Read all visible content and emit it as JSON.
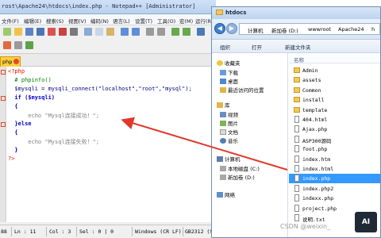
{
  "npp": {
    "title": "rost\\Apache24\\htdocs\\index.php - Notepad++ [Administrator]",
    "menu": [
      "文件(F)",
      "编辑(E)",
      "搜索(S)",
      "视图(V)",
      "编码(N)",
      "语言(L)",
      "设置(T)",
      "工具(O)",
      "宏(M)",
      "运行(R)"
    ],
    "tab_label": "php",
    "code": [
      "<?php",
      "  # phpinfo()",
      "  $mysqli = mysqli_connect(\"localhost\",\"root\",\"mysql\");",
      "  if ($mysqli)",
      "  {",
      "      echo \"Mysql连接成功！\";",
      "  }else",
      "  {",
      "      echo \"Mysql连接失败！\";",
      "  }",
      "?>"
    ],
    "status": {
      "ln": "88",
      "line": "Ln : 11",
      "col": "Col : 3",
      "sel": "Sel : 0 | 0",
      "eol": "Windows (CR LF)",
      "enc": "GB2312 (Si"
    }
  },
  "explorer": {
    "title": "htdocs",
    "address": [
      "计算机",
      "新加卷 (D:)",
      "wwwroot",
      "Apache24",
      "h"
    ],
    "commands": [
      "组织",
      "打开",
      "新建文件夹"
    ],
    "nav": [
      {
        "label": "收藏夹",
        "icon": "star-icon"
      },
      {
        "label": "下载",
        "icon": "download-folder-icon"
      },
      {
        "label": "桌面",
        "icon": "desktop-icon"
      },
      {
        "label": "最近访问的位置",
        "icon": "recent-places-icon"
      },
      {
        "label": "库",
        "icon": "library-icon"
      },
      {
        "label": "视频",
        "icon": "video-icon"
      },
      {
        "label": "图片",
        "icon": "picture-icon"
      },
      {
        "label": "文档",
        "icon": "document-icon"
      },
      {
        "label": "音乐",
        "icon": "music-icon"
      },
      {
        "label": "计算机",
        "icon": "computer-icon"
      },
      {
        "label": "本地磁盘 (C:)",
        "icon": "drive-icon"
      },
      {
        "label": "新加卷 (D:)",
        "icon": "drive-icon"
      },
      {
        "label": "网络",
        "icon": "network-icon"
      }
    ],
    "column_header": "名称",
    "files": [
      {
        "name": "Admin",
        "type": "folder"
      },
      {
        "name": "assets",
        "type": "folder"
      },
      {
        "name": "Common",
        "type": "folder"
      },
      {
        "name": "install",
        "type": "folder"
      },
      {
        "name": "template",
        "type": "folder"
      },
      {
        "name": "404.html",
        "type": "file"
      },
      {
        "name": "Ajax.php",
        "type": "file"
      },
      {
        "name": "ASP300源码",
        "type": "file"
      },
      {
        "name": "foot.php",
        "type": "file"
      },
      {
        "name": "index.htm",
        "type": "file"
      },
      {
        "name": "index.html",
        "type": "file"
      },
      {
        "name": "index.php",
        "type": "file",
        "selected": true
      },
      {
        "name": "index.php2",
        "type": "file"
      },
      {
        "name": "indexx.php",
        "type": "file"
      },
      {
        "name": "project.php",
        "type": "file"
      },
      {
        "name": "说明.txt",
        "type": "file"
      }
    ]
  },
  "watermark": {
    "text": "CSDN @weixin_",
    "logo": "AI"
  },
  "colors": {
    "arrow": "#e0392b",
    "selection": "#3399ff",
    "tab": "#ffcf40"
  }
}
